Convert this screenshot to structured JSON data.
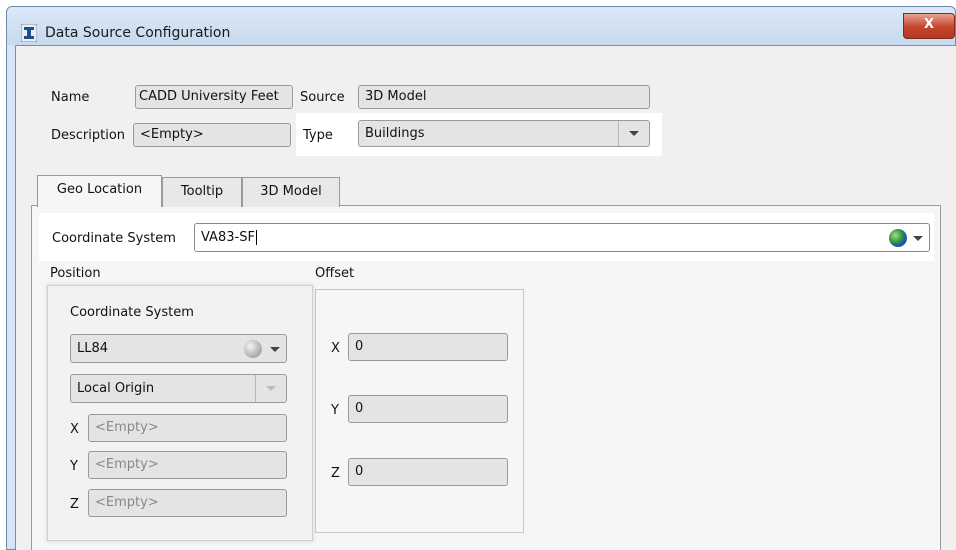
{
  "window": {
    "title": "Data Source Configuration",
    "close_label": "X"
  },
  "form": {
    "name_label": "Name",
    "name_value": "CADD University Feet",
    "source_label": "Source",
    "source_value": "3D Model",
    "description_label": "Description",
    "description_value": "<Empty>",
    "type_label": "Type",
    "type_value": "Buildings"
  },
  "tabs": [
    {
      "label": "Geo Location",
      "active": true
    },
    {
      "label": "Tooltip",
      "active": false
    },
    {
      "label": "3D Model",
      "active": false
    }
  ],
  "geo": {
    "coord_system_label": "Coordinate System",
    "coord_system_value": "VA83-SF",
    "position_label": "Position",
    "offset_label": "Offset"
  },
  "position": {
    "coord_system_label": "Coordinate System",
    "coord_system_value": "LL84",
    "origin_value": "Local Origin",
    "x_label": "X",
    "x_placeholder": "<Empty>",
    "y_label": "Y",
    "y_placeholder": "<Empty>",
    "z_label": "Z",
    "z_placeholder": "<Empty>"
  },
  "offset": {
    "x_label": "X",
    "x_value": "0",
    "y_label": "Y",
    "y_value": "0",
    "z_label": "Z",
    "z_value": "0"
  },
  "icons": {
    "app": "app-logo-icon",
    "globe": "globe-icon",
    "dropdown": "chevron-down-icon"
  },
  "colors": {
    "accent_close": "#c4432b",
    "titlebar": "#c6d9ee",
    "background": "#f0f0f0"
  }
}
